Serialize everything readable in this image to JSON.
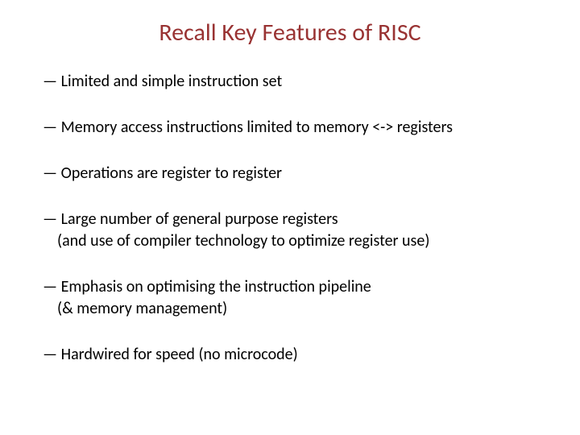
{
  "slide": {
    "title": "Recall Key Features of RISC",
    "bullets": [
      {
        "line1": "— Limited and simple instruction set"
      },
      {
        "line1": "— Memory access instructions limited to memory <-> registers"
      },
      {
        "line1": "— Operations are register to register"
      },
      {
        "line1": "— Large number of general purpose registers",
        "line2": "(and use of compiler technology to optimize register use)"
      },
      {
        "line1": "— Emphasis on optimising the instruction pipeline",
        "line2": "(& memory management)"
      },
      {
        "line1": "— Hardwired for speed (no microcode)"
      }
    ]
  }
}
